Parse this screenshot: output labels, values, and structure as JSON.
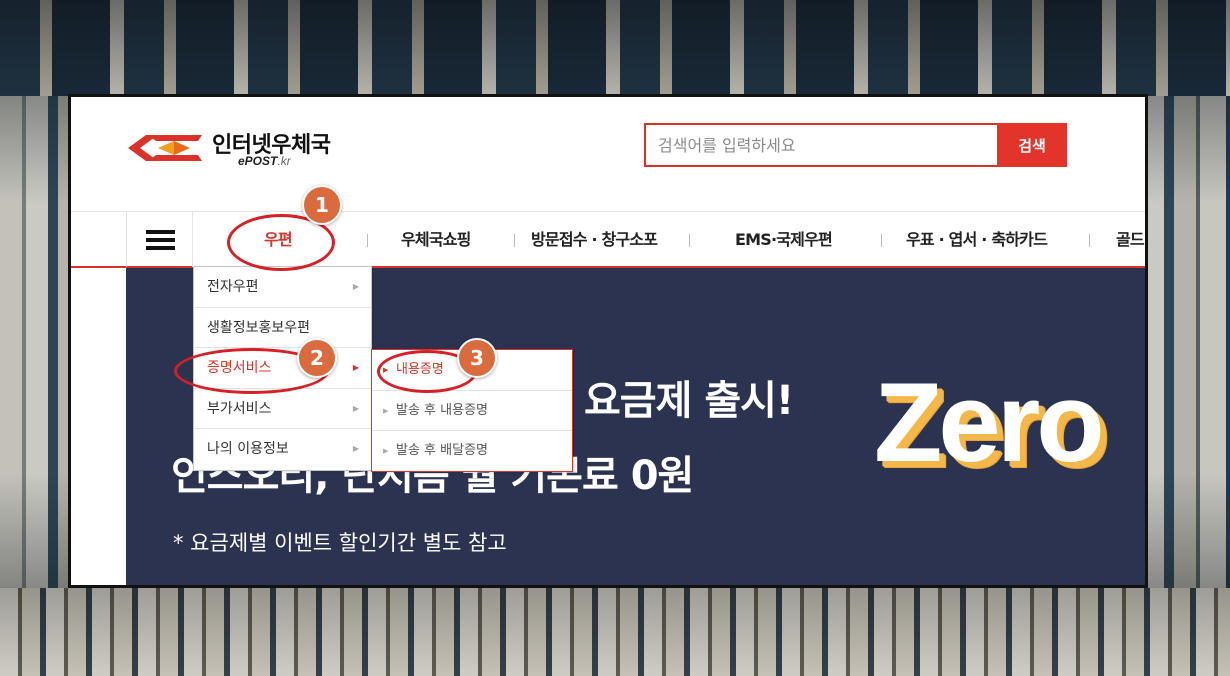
{
  "logo": {
    "name": "인터넷우체국",
    "sub_main": "ePOST",
    "sub_domain": ".kr"
  },
  "search": {
    "placeholder": "검색어를 입력하세요",
    "button_label": "검색"
  },
  "nav": {
    "items": [
      {
        "label": "우편"
      },
      {
        "label": "우체국쇼핑"
      },
      {
        "label": "방문접수 · 창구소포"
      },
      {
        "label": "EMS·국제우편"
      },
      {
        "label": "우표 · 엽서 · 축하카드"
      },
      {
        "label": "골드"
      }
    ]
  },
  "menu": {
    "items": [
      {
        "label": "전자우편"
      },
      {
        "label": "생활정보홍보우편"
      },
      {
        "label": "증명서비스"
      },
      {
        "label": "부가서비스"
      },
      {
        "label": "나의 이용정보"
      }
    ],
    "submenu": [
      {
        "label": "내용증명"
      },
      {
        "label": "발송 후 내용증명"
      },
      {
        "label": "발송 후 배달증명"
      }
    ]
  },
  "banner": {
    "line1": "요금제 출시!",
    "line2": "인스오리, 단지음 월 기본료 0원",
    "note": "* 요금제별 이벤트 할인기간 별도 참고",
    "zero": "Zero"
  },
  "annotations": {
    "badge1": "1",
    "badge2": "2",
    "badge3": "3"
  },
  "colors": {
    "brand_red": "#d8322b",
    "banner_bg": "#2b3350",
    "badge": "#d96b3f"
  }
}
